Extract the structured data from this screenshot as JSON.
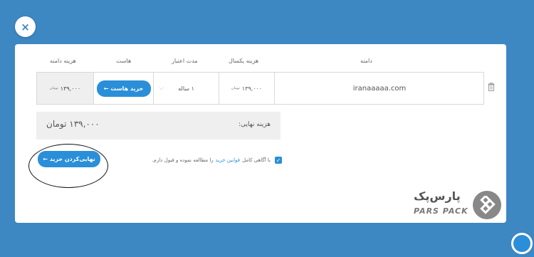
{
  "close_label": "×",
  "table": {
    "headers": {
      "domain": "دامنه",
      "annual_cost": "هزینه یکسال",
      "validity": "مدت اعتبار",
      "host": "هاست",
      "domain_cost": "هزینه دامنه"
    },
    "row": {
      "domain": "iranaaaaa.com",
      "annual_cost": "۱۳۹,۰۰۰",
      "annual_unit": "تومان",
      "period": "۱ ساله",
      "host_button": "خرید هاست ←",
      "domain_cost": "۱۳۹,۰۰۰",
      "domain_cost_unit": "تومان"
    }
  },
  "total": {
    "label": "هزینه نهایی:",
    "value": "۱۳۹,۰۰۰ تومان"
  },
  "terms": {
    "prefix": "با آگاهی کامل",
    "link": "قوانین خرید",
    "suffix": "را مطالعه نموده و قبول دارم."
  },
  "finalize_button": "نهایی‌کردن خرید ←",
  "brand": {
    "name_fa": "پارس‌پک",
    "name_en": "PARS PACK"
  },
  "colors": {
    "background": "#3d87c3",
    "accent": "#2a8fd8"
  }
}
